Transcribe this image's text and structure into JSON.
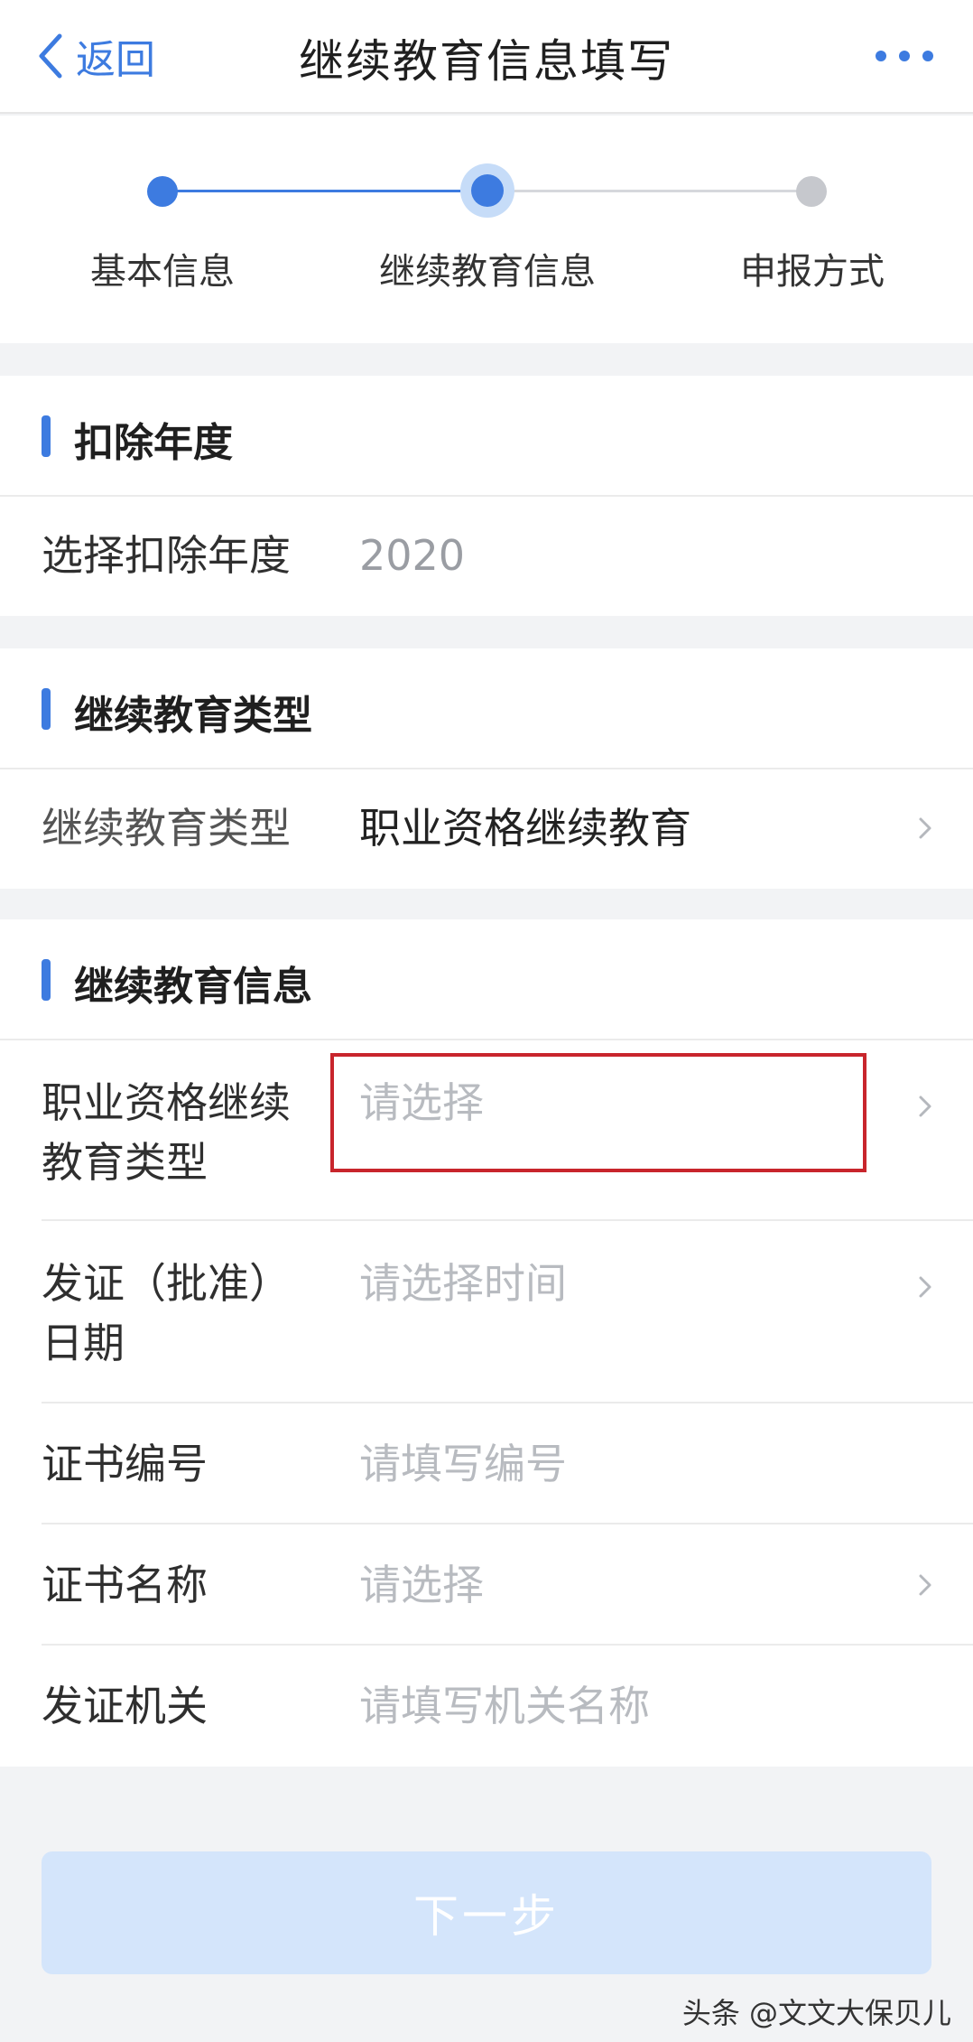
{
  "navbar": {
    "back_label": "返回",
    "title": "继续教育信息填写",
    "more_icon": "ellipsis-icon"
  },
  "steps": [
    {
      "label": "基本信息",
      "state": "done"
    },
    {
      "label": "继续教育信息",
      "state": "current"
    },
    {
      "label": "申报方式",
      "state": "todo"
    }
  ],
  "sections": {
    "deduction_year": {
      "title": "扣除年度",
      "row_label": "选择扣除年度",
      "row_value": "2020"
    },
    "edu_type": {
      "title": "继续教育类型",
      "row_label": "继续教育类型",
      "row_value": "职业资格继续教育"
    },
    "edu_info": {
      "title": "继续教育信息",
      "fields": [
        {
          "label_line1": "职业资格继续",
          "label_line2": "教育类型",
          "placeholder": "请选择"
        },
        {
          "label_line1": "发证（批准）",
          "label_line2": "日期",
          "placeholder": "请选择时间"
        },
        {
          "label": "证书编号",
          "placeholder": "请填写编号"
        },
        {
          "label": "证书名称",
          "placeholder": "请选择"
        },
        {
          "label": "发证机关",
          "placeholder": "请填写机关名称"
        }
      ]
    }
  },
  "next_button": "下一步",
  "watermark": "头条 @文文大保贝儿",
  "colors": {
    "accent": "#3d7be0",
    "highlight_box": "#c8252c",
    "button_disabled": "#d4e5fb"
  }
}
